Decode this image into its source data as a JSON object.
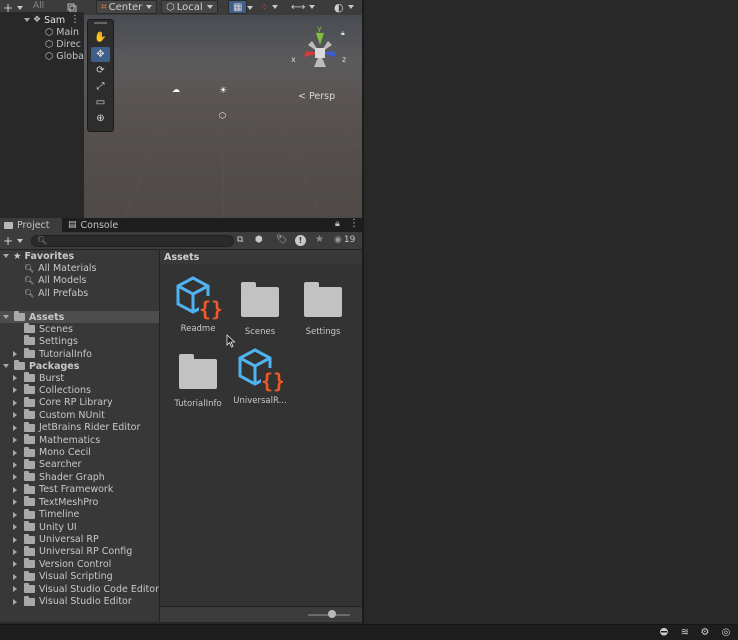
{
  "toolbar": {
    "add_glyph": "+",
    "hierarchy_search_placeholder": "All",
    "pivot_label": "Center",
    "space_label": "Local"
  },
  "hierarchy": {
    "root_label": "Sam",
    "items": [
      "Main",
      "Direc",
      "Globa"
    ]
  },
  "scene": {
    "projection_label": "Persp",
    "axis_labels": {
      "x": "x",
      "y": "y",
      "z": "z"
    }
  },
  "tabs": [
    {
      "label": "Project",
      "icon": "folder-icon",
      "active": true
    },
    {
      "label": "Console",
      "icon": "console-icon",
      "active": false
    }
  ],
  "project_toolbar": {
    "add_glyph": "+",
    "search_placeholder": "",
    "hidden_count": "19"
  },
  "tree": {
    "favorites": {
      "label": "Favorites",
      "items": [
        "All Materials",
        "All Models",
        "All Prefabs"
      ]
    },
    "assets": {
      "label": "Assets",
      "items": [
        {
          "label": "Scenes",
          "expandable": false
        },
        {
          "label": "Settings",
          "expandable": false
        },
        {
          "label": "TutorialInfo",
          "expandable": true
        }
      ]
    },
    "packages": {
      "label": "Packages",
      "items": [
        "Burst",
        "Collections",
        "Core RP Library",
        "Custom NUnit",
        "JetBrains Rider Editor",
        "Mathematics",
        "Mono Cecil",
        "Searcher",
        "Shader Graph",
        "Test Framework",
        "TextMeshPro",
        "Timeline",
        "Unity UI",
        "Universal RP",
        "Universal RP Config",
        "Version Control",
        "Visual Scripting",
        "Visual Studio Code Editor",
        "Visual Studio Editor"
      ]
    }
  },
  "assets_view": {
    "header": "Assets",
    "items": [
      {
        "label": "Readme",
        "kind": "asset",
        "icon": "script-asset-icon"
      },
      {
        "label": "Scenes",
        "kind": "folder",
        "icon": "folder-icon"
      },
      {
        "label": "Settings",
        "kind": "folder",
        "icon": "folder-icon"
      },
      {
        "label": "TutorialInfo",
        "kind": "folder",
        "icon": "folder-icon"
      },
      {
        "label": "UniversalR...",
        "kind": "asset",
        "icon": "script-asset-icon"
      }
    ]
  },
  "colors": {
    "accent_blue": "#4fb3f0",
    "brace_orange": "#f05a28",
    "gizmo_red": "#d43c3c",
    "gizmo_green": "#7ec03c",
    "gizmo_blue": "#3c5ad4"
  }
}
